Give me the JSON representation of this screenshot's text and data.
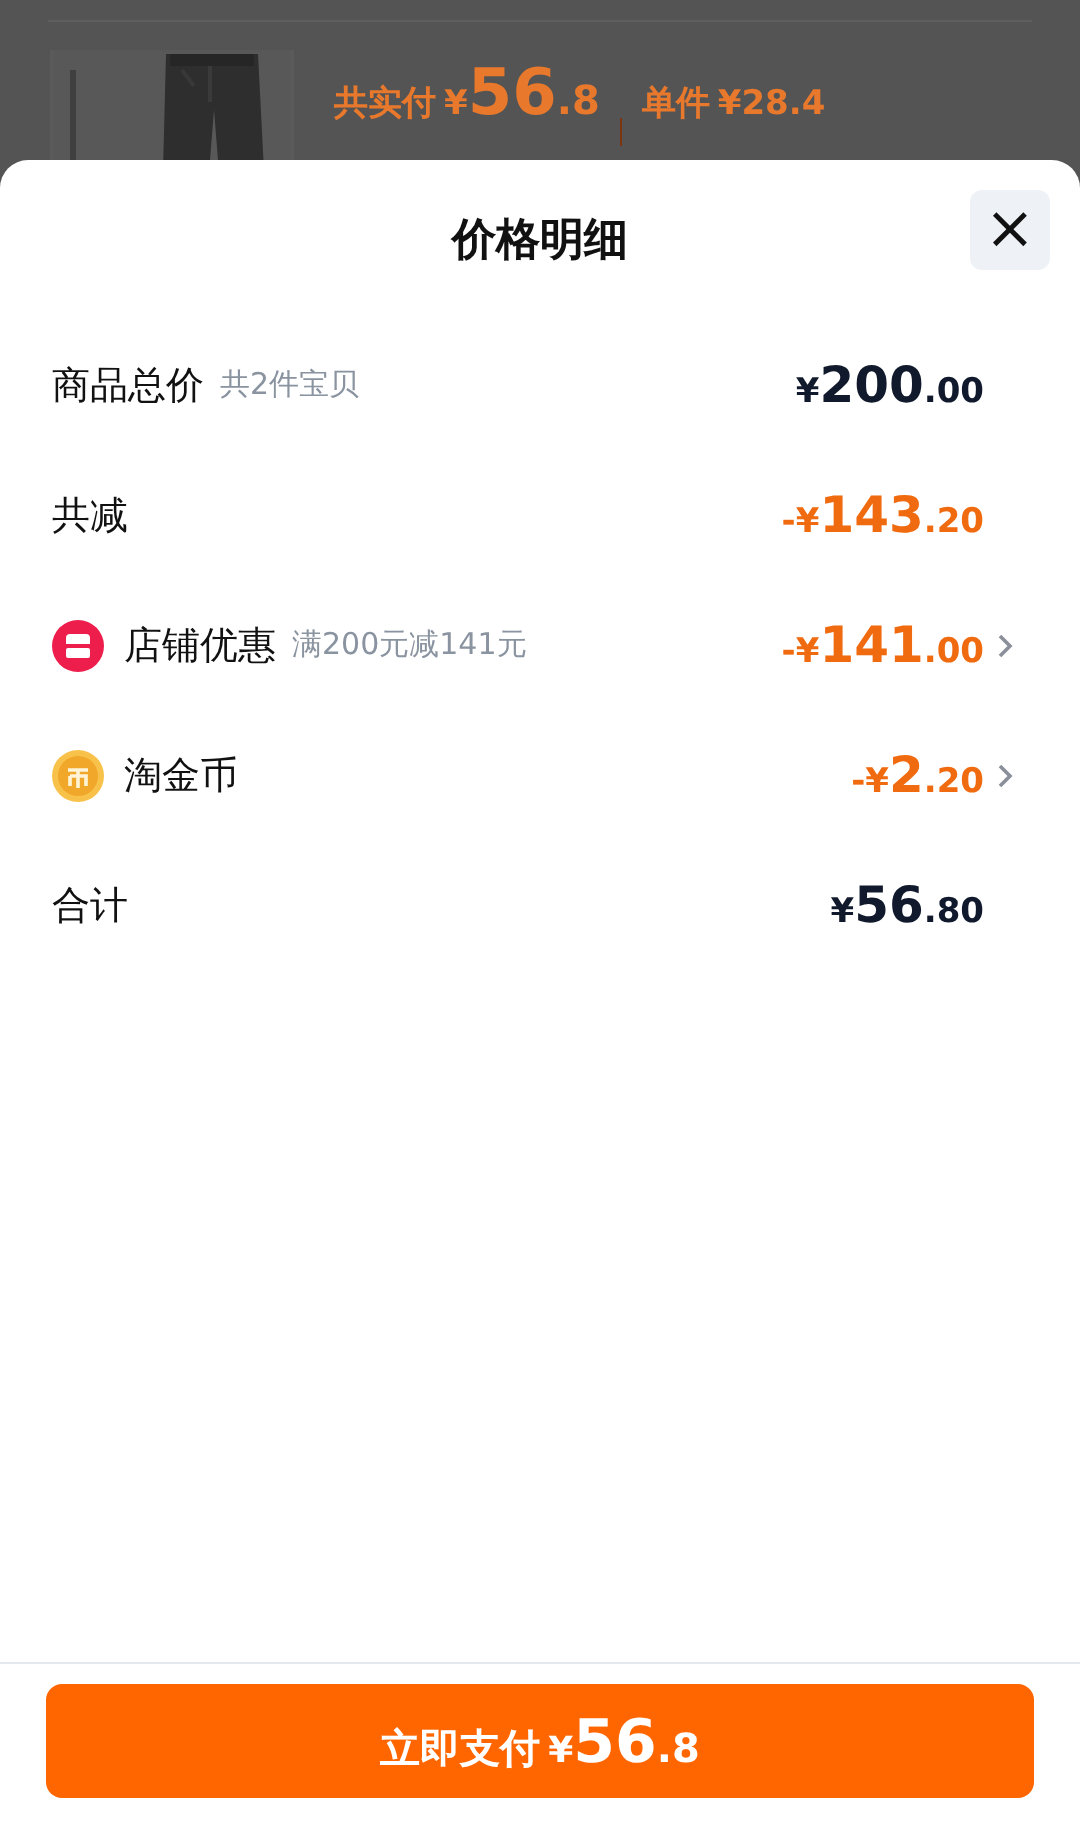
{
  "background": {
    "product": {
      "paid_label": "共实付",
      "paid_currency": "¥",
      "paid_integer": "56",
      "paid_fraction": ".8",
      "unit_label": "单件",
      "unit_price": "¥28.4"
    }
  },
  "sheet": {
    "title": "价格明细",
    "close": "×",
    "rows": [
      {
        "kind": "sum",
        "label": "商品总价",
        "note": "共2件宝贝",
        "expandable": false,
        "amount": {
          "currency": "¥",
          "integer": "200",
          "fraction": ".00"
        }
      },
      {
        "kind": "deduction",
        "label": "共减",
        "expandable": false,
        "amount": {
          "sign": "-",
          "currency": "¥",
          "integer": "143",
          "fraction": ".20"
        }
      },
      {
        "kind": "store",
        "label": "店铺优惠",
        "note": "满200元减141元",
        "expandable": true,
        "amount": {
          "sign": "-",
          "currency": "¥",
          "integer": "141",
          "fraction": ".00"
        }
      },
      {
        "kind": "coin",
        "label": "淘金币",
        "expandable": true,
        "amount": {
          "sign": "-",
          "currency": "¥",
          "integer": "2",
          "fraction": ".20"
        }
      },
      {
        "kind": "sum",
        "label": "合计",
        "expandable": false,
        "amount": {
          "currency": "¥",
          "integer": "56",
          "fraction": ".80"
        }
      }
    ],
    "pay_button": {
      "label": "立即支付",
      "currency": "¥",
      "integer": "56",
      "fraction": ".8"
    }
  }
}
